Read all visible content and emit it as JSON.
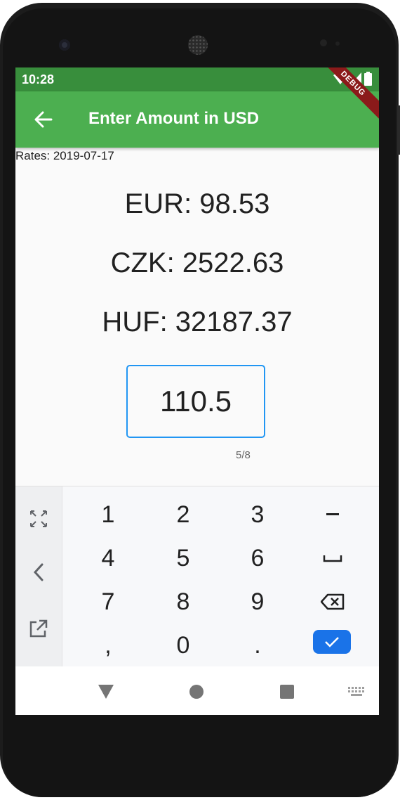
{
  "status_bar": {
    "time": "10:28"
  },
  "app_bar": {
    "title": "Enter Amount in USD",
    "debug_banner": "DEBUG"
  },
  "rates_date": "Rates: 2019-07-17",
  "conversions": [
    {
      "text": "EUR: 98.53"
    },
    {
      "text": "CZK: 2522.63"
    },
    {
      "text": "HUF: 32187.37"
    }
  ],
  "amount_input": {
    "value": "110.5",
    "counter": "5/8"
  },
  "keyboard": {
    "rows": [
      [
        "1",
        "2",
        "3",
        "−"
      ],
      [
        "4",
        "5",
        "6",
        "␣"
      ],
      [
        "7",
        "8",
        "9",
        "⌫"
      ],
      [
        ",",
        "0",
        ".",
        "✓"
      ]
    ]
  },
  "colors": {
    "status_bar": "#388e3c",
    "app_bar": "#4caf50",
    "accent": "#2196f3",
    "enter_key": "#1a73e8"
  }
}
